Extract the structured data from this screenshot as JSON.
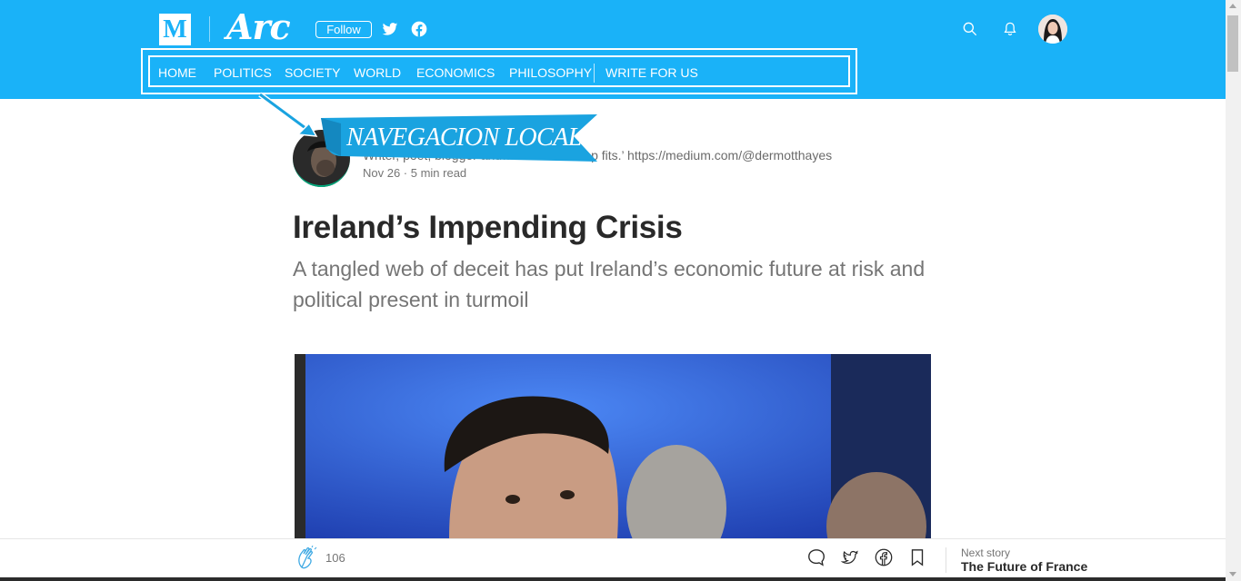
{
  "header": {
    "medium_logo": "M",
    "publication_logo": "Arc",
    "follow_label": "Follow",
    "icons": [
      "twitter-icon",
      "facebook-icon",
      "search-icon",
      "bell-icon",
      "avatar"
    ],
    "accent_color": "#1ab2f8"
  },
  "nav": {
    "items": [
      "HOME",
      "POLITICS",
      "SOCIETY",
      "WORLD",
      "ECONOMICS",
      "PHILOSOPHY",
      "WRITE FOR US"
    ]
  },
  "annotation": {
    "label": "NAVEGACION LOCAL"
  },
  "author": {
    "bio": "Writer, poet, blogger and… ant. ‘If the cap fits.’ https://medium.com/@dermotthayes",
    "meta": "Nov 26 · 5 min read"
  },
  "article": {
    "title": "Ireland’s Impending Crisis",
    "subtitle": "A tangled web of deceit has put Ireland’s economic future at risk and political present in turmoil"
  },
  "bottom_bar": {
    "clap_count": "106",
    "icons": [
      "clap-icon",
      "comment-icon",
      "twitter-icon",
      "facebook-icon",
      "bookmark-icon"
    ],
    "next_label": "Next story",
    "next_title": "The Future of France"
  }
}
